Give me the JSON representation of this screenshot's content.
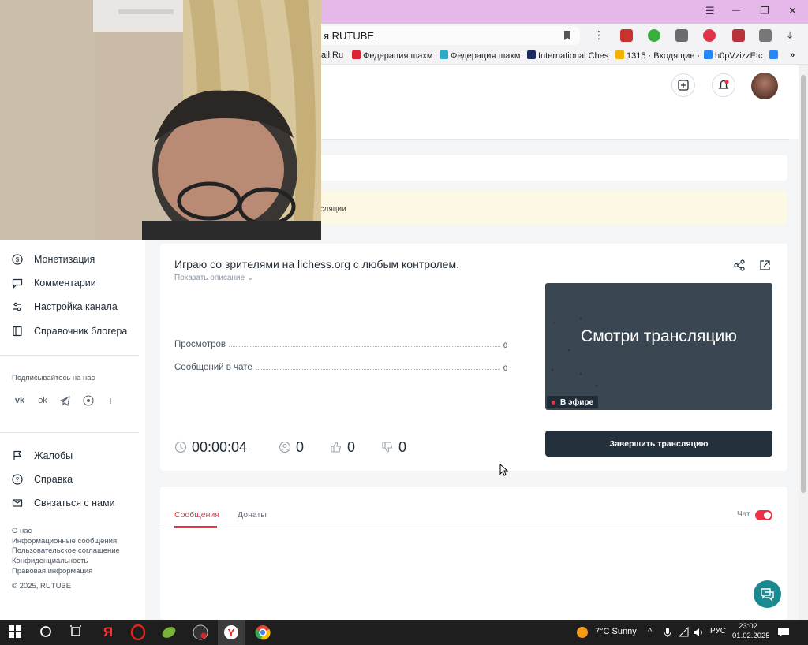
{
  "browser": {
    "tab_title": "я RUTUBE",
    "bookmarks": [
      "ail.Ru",
      "Федерация шахм",
      "Федерация шахм",
      "International Ches",
      "1315 · Входящие ·",
      "h0pVzizzEtc"
    ],
    "window_controls": {
      "menu": "☰",
      "minimize": "—",
      "maximize": "❐",
      "close": "✕"
    }
  },
  "notice": {
    "text": "нсляции"
  },
  "sidebar": {
    "items": [
      {
        "label": "Монетизация",
        "icon": "dollar-icon"
      },
      {
        "label": "Комментарии",
        "icon": "comment-icon"
      },
      {
        "label": "Настройка канала",
        "icon": "settings-icon"
      },
      {
        "label": "Справочник блогера",
        "icon": "book-icon"
      }
    ],
    "follow_label": "Подписывайтесь на нас",
    "social": [
      "vk-icon",
      "ok-icon",
      "telegram-icon",
      "viber-icon",
      "plus-icon"
    ],
    "support": [
      {
        "label": "Жалобы",
        "icon": "flag-icon"
      },
      {
        "label": "Справка",
        "icon": "help-icon"
      },
      {
        "label": "Связаться с нами",
        "icon": "mail-icon"
      }
    ],
    "footer_links": [
      "О нас",
      "Информационные сообщения",
      "Пользовательское соглашение",
      "Конфиденциальность",
      "Правовая информация"
    ],
    "copyright": "© 2025, RUTUBE"
  },
  "stream": {
    "title": "Играю со зрителями на lichess.org с любым контролем.",
    "show_description": "Показать описание",
    "stats": [
      {
        "label": "Просмотров",
        "value": "0"
      },
      {
        "label": "Сообщений в чате",
        "value": "0"
      }
    ],
    "duration": "00:00:04",
    "viewers": "0",
    "likes": "0",
    "dislikes": "0",
    "preview_text": "Смотри трансляцию",
    "live_badge": "В эфире",
    "end_button": "Завершить трансляцию"
  },
  "chat_section": {
    "tabs": [
      "Сообщения",
      "Донаты"
    ],
    "active_tab": "Сообщения",
    "chat_toggle_label": "Чат",
    "chat_enabled": true
  },
  "taskbar": {
    "weather": "7°C  Sunny",
    "language": "РУС",
    "time": "23:02",
    "date": "01.02.2025"
  },
  "colors": {
    "accent": "#f22f46",
    "dark": "#24303b",
    "page_bg": "#f4f5f7",
    "titlebar": "#e6b8ea"
  }
}
